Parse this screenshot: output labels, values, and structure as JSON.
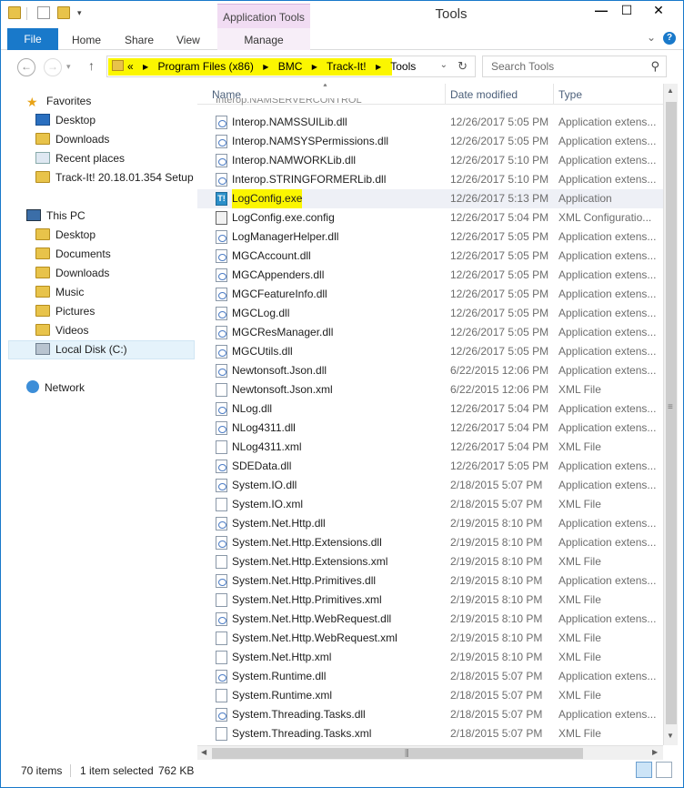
{
  "window": {
    "title": "Tools",
    "contextual_tab": "Application Tools"
  },
  "ribbon": {
    "tabs": [
      "File",
      "Home",
      "Share",
      "View",
      "Manage"
    ]
  },
  "address": {
    "overflow": "«",
    "crumbs": [
      "Program Files (x86)",
      "BMC",
      "Track-It!",
      "Tools"
    ],
    "search_placeholder": "Search Tools"
  },
  "nav": {
    "favorites_label": "Favorites",
    "favorites": [
      "Desktop",
      "Downloads",
      "Recent places",
      "Track-It! 20.18.01.354 Setup"
    ],
    "thispc_label": "This PC",
    "thispc": [
      "Desktop",
      "Documents",
      "Downloads",
      "Music",
      "Pictures",
      "Videos",
      "Local Disk (C:)"
    ],
    "network_label": "Network"
  },
  "columns": {
    "name": "Name",
    "date": "Date modified",
    "type": "Type"
  },
  "files": [
    {
      "name": "Interop.NAMSSUILib.dll",
      "date": "12/26/2017 5:05 PM",
      "type": "Application extens...",
      "icon": "dll"
    },
    {
      "name": "Interop.NAMSYSPermissions.dll",
      "date": "12/26/2017 5:05 PM",
      "type": "Application extens...",
      "icon": "dll"
    },
    {
      "name": "Interop.NAMWORKLib.dll",
      "date": "12/26/2017 5:10 PM",
      "type": "Application extens...",
      "icon": "dll"
    },
    {
      "name": "Interop.STRINGFORMERLib.dll",
      "date": "12/26/2017 5:10 PM",
      "type": "Application extens...",
      "icon": "dll"
    },
    {
      "name": "LogConfig.exe",
      "date": "12/26/2017 5:13 PM",
      "type": "Application",
      "icon": "exe",
      "selected": true
    },
    {
      "name": "LogConfig.exe.config",
      "date": "12/26/2017 5:04 PM",
      "type": "XML Configuratio...",
      "icon": "cfg"
    },
    {
      "name": "LogManagerHelper.dll",
      "date": "12/26/2017 5:05 PM",
      "type": "Application extens...",
      "icon": "dll"
    },
    {
      "name": "MGCAccount.dll",
      "date": "12/26/2017 5:05 PM",
      "type": "Application extens...",
      "icon": "dll"
    },
    {
      "name": "MGCAppenders.dll",
      "date": "12/26/2017 5:05 PM",
      "type": "Application extens...",
      "icon": "dll"
    },
    {
      "name": "MGCFeatureInfo.dll",
      "date": "12/26/2017 5:05 PM",
      "type": "Application extens...",
      "icon": "dll"
    },
    {
      "name": "MGCLog.dll",
      "date": "12/26/2017 5:05 PM",
      "type": "Application extens...",
      "icon": "dll"
    },
    {
      "name": "MGCResManager.dll",
      "date": "12/26/2017 5:05 PM",
      "type": "Application extens...",
      "icon": "dll"
    },
    {
      "name": "MGCUtils.dll",
      "date": "12/26/2017 5:05 PM",
      "type": "Application extens...",
      "icon": "dll"
    },
    {
      "name": "Newtonsoft.Json.dll",
      "date": "6/22/2015 12:06 PM",
      "type": "Application extens...",
      "icon": "dll"
    },
    {
      "name": "Newtonsoft.Json.xml",
      "date": "6/22/2015 12:06 PM",
      "type": "XML File",
      "icon": "xml"
    },
    {
      "name": "NLog.dll",
      "date": "12/26/2017 5:04 PM",
      "type": "Application extens...",
      "icon": "dll"
    },
    {
      "name": "NLog4311.dll",
      "date": "12/26/2017 5:04 PM",
      "type": "Application extens...",
      "icon": "dll"
    },
    {
      "name": "NLog4311.xml",
      "date": "12/26/2017 5:04 PM",
      "type": "XML File",
      "icon": "xml"
    },
    {
      "name": "SDEData.dll",
      "date": "12/26/2017 5:05 PM",
      "type": "Application extens...",
      "icon": "dll"
    },
    {
      "name": "System.IO.dll",
      "date": "2/18/2015 5:07 PM",
      "type": "Application extens...",
      "icon": "dll"
    },
    {
      "name": "System.IO.xml",
      "date": "2/18/2015 5:07 PM",
      "type": "XML File",
      "icon": "xml"
    },
    {
      "name": "System.Net.Http.dll",
      "date": "2/19/2015 8:10 PM",
      "type": "Application extens...",
      "icon": "dll"
    },
    {
      "name": "System.Net.Http.Extensions.dll",
      "date": "2/19/2015 8:10 PM",
      "type": "Application extens...",
      "icon": "dll"
    },
    {
      "name": "System.Net.Http.Extensions.xml",
      "date": "2/19/2015 8:10 PM",
      "type": "XML File",
      "icon": "xml"
    },
    {
      "name": "System.Net.Http.Primitives.dll",
      "date": "2/19/2015 8:10 PM",
      "type": "Application extens...",
      "icon": "dll"
    },
    {
      "name": "System.Net.Http.Primitives.xml",
      "date": "2/19/2015 8:10 PM",
      "type": "XML File",
      "icon": "xml"
    },
    {
      "name": "System.Net.Http.WebRequest.dll",
      "date": "2/19/2015 8:10 PM",
      "type": "Application extens...",
      "icon": "dll"
    },
    {
      "name": "System.Net.Http.WebRequest.xml",
      "date": "2/19/2015 8:10 PM",
      "type": "XML File",
      "icon": "xml"
    },
    {
      "name": "System.Net.Http.xml",
      "date": "2/19/2015 8:10 PM",
      "type": "XML File",
      "icon": "xml"
    },
    {
      "name": "System.Runtime.dll",
      "date": "2/18/2015 5:07 PM",
      "type": "Application extens...",
      "icon": "dll"
    },
    {
      "name": "System.Runtime.xml",
      "date": "2/18/2015 5:07 PM",
      "type": "XML File",
      "icon": "xml"
    },
    {
      "name": "System.Threading.Tasks.dll",
      "date": "2/18/2015 5:07 PM",
      "type": "Application extens...",
      "icon": "dll"
    },
    {
      "name": "System.Threading.Tasks.xml",
      "date": "2/18/2015 5:07 PM",
      "type": "XML File",
      "icon": "xml"
    }
  ],
  "status": {
    "items": "70 items",
    "selected": "1 item selected",
    "size": "762 KB"
  },
  "colors": {
    "accent": "#1979ca",
    "highlight": "#fbf600",
    "context_tab": "#f1dcf3"
  }
}
